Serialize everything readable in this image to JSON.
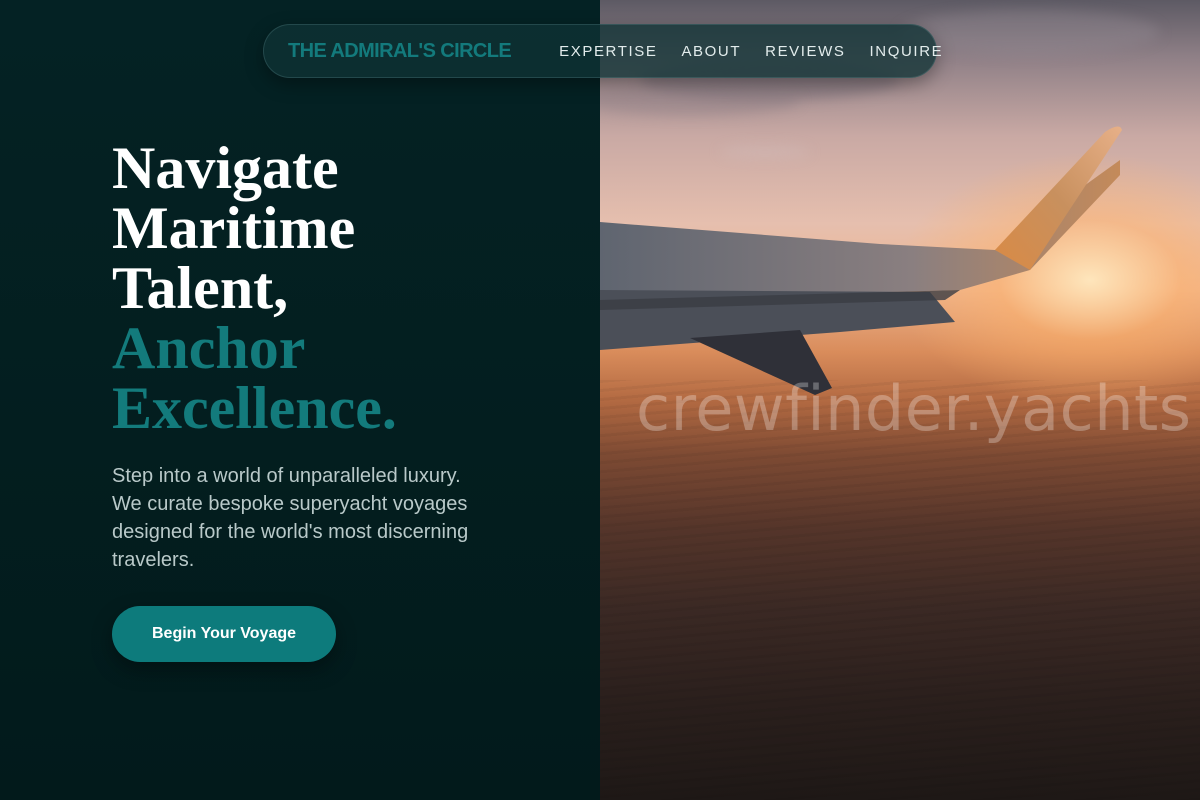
{
  "nav": {
    "brand": "THE ADMIRAL'S CIRCLE",
    "links": [
      {
        "label": "EXPERTISE"
      },
      {
        "label": "ABOUT"
      },
      {
        "label": "REVIEWS"
      },
      {
        "label": "INQUIRE"
      }
    ]
  },
  "hero": {
    "headline_lines": [
      "Navigate",
      "Maritime",
      "Talent,"
    ],
    "headline_accent_lines": [
      "Anchor",
      "Excellence."
    ],
    "subtext": "Step into a world of unparalleled luxury. We curate bespoke superyacht voyages designed for the world's most discerning travelers.",
    "cta_label": "Begin Your Voyage",
    "image_watermark": "crewfinder.yachts"
  },
  "colors": {
    "background": "#031e20",
    "accent": "#0d7b7c",
    "heading": "#ffffff",
    "body_text": "#b9c9c9"
  }
}
